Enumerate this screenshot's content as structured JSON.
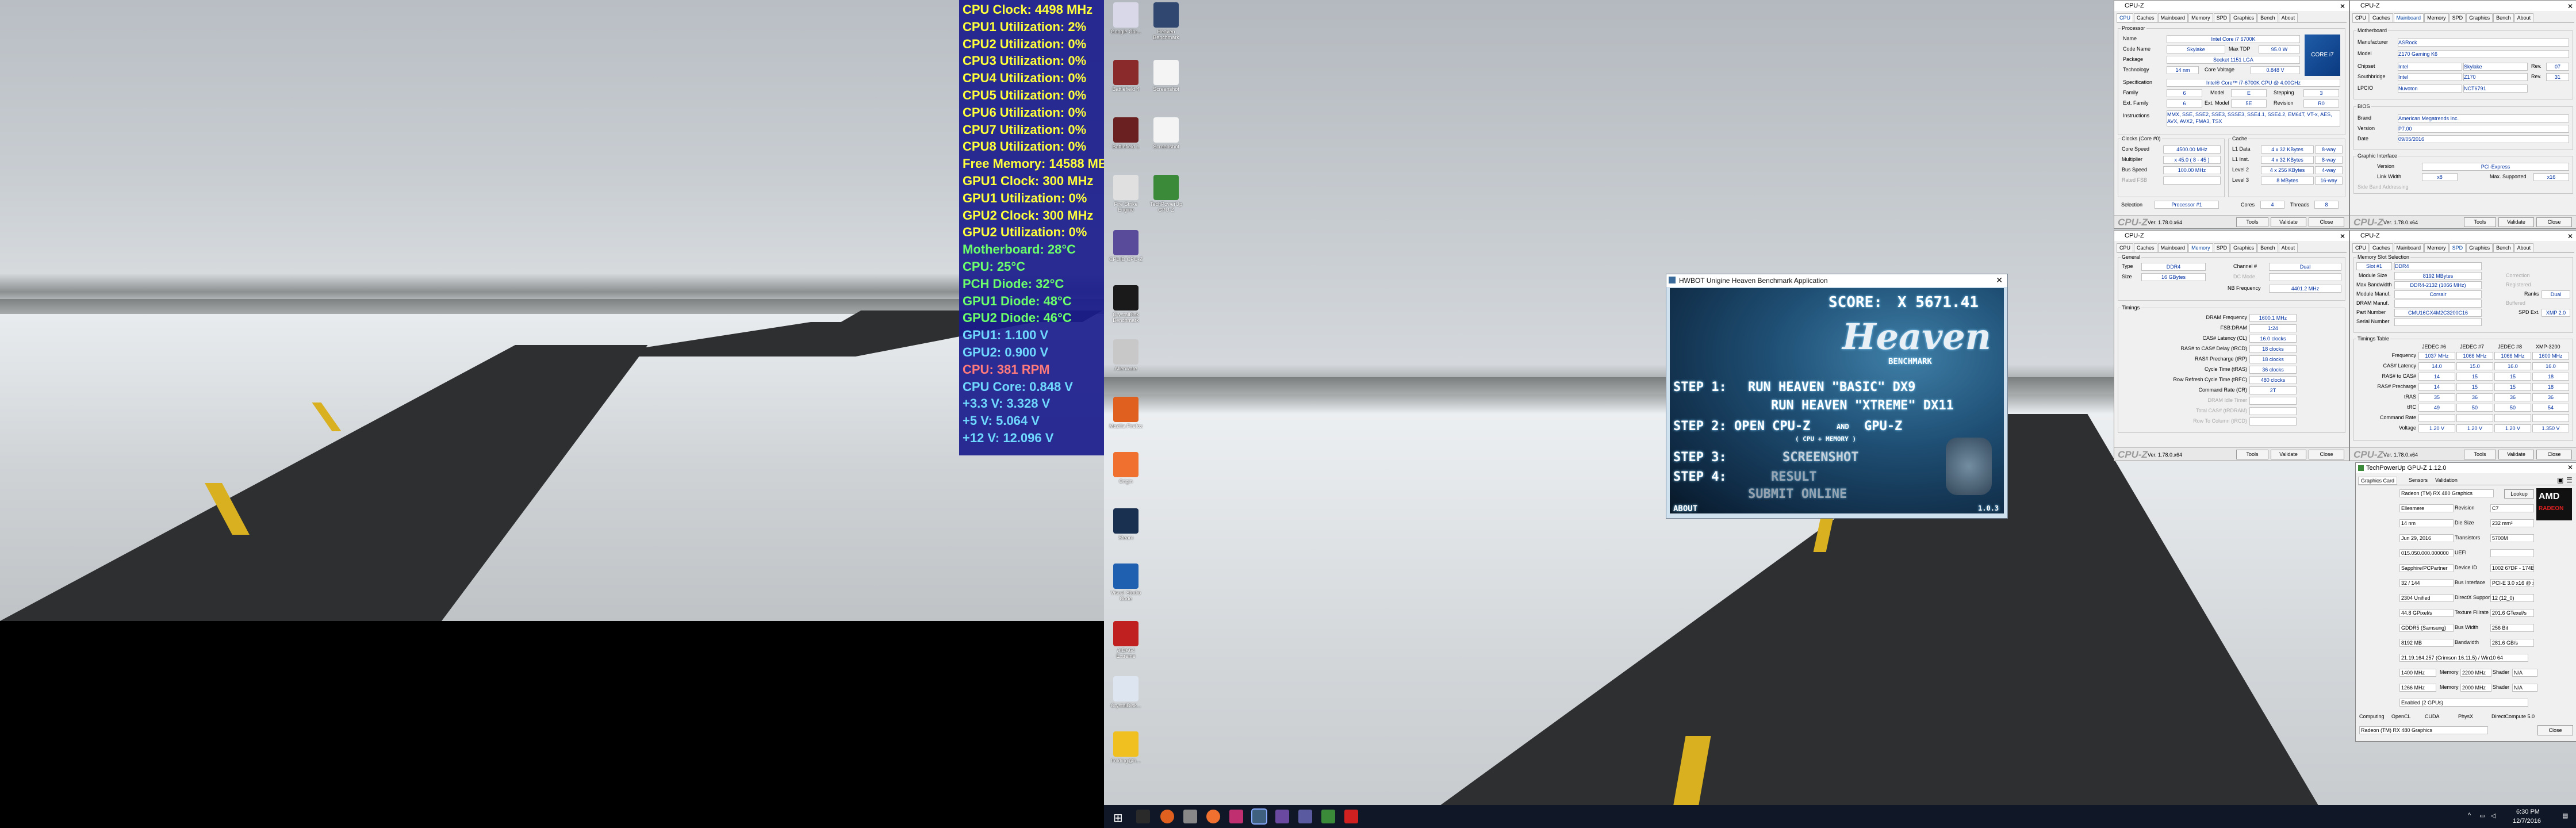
{
  "osd": {
    "lines": [
      {
        "text": "CPU Clock: 4498 MHz",
        "color": "#ffff3c"
      },
      {
        "text": "CPU1 Utilization: 2%",
        "color": "#ffff3c"
      },
      {
        "text": "CPU2 Utilization: 0%",
        "color": "#ffff3c"
      },
      {
        "text": "CPU3 Utilization: 0%",
        "color": "#ffff3c"
      },
      {
        "text": "CPU4 Utilization: 0%",
        "color": "#ffff3c"
      },
      {
        "text": "CPU5 Utilization: 0%",
        "color": "#ffff3c"
      },
      {
        "text": "CPU6 Utilization: 0%",
        "color": "#ffff3c"
      },
      {
        "text": "CPU7 Utilization: 0%",
        "color": "#ffff3c"
      },
      {
        "text": "CPU8 Utilization: 0%",
        "color": "#ffff3c"
      },
      {
        "text": "Free Memory: 14588 MB",
        "color": "#ffff3c"
      },
      {
        "text": "GPU1 Clock: 300 MHz",
        "color": "#ffff3c"
      },
      {
        "text": "GPU1 Utilization: 0%",
        "color": "#ffff3c"
      },
      {
        "text": "GPU2 Clock: 300 MHz",
        "color": "#ffff3c"
      },
      {
        "text": "GPU2 Utilization: 0%",
        "color": "#ffff3c"
      },
      {
        "text": "Motherboard: 28°C",
        "color": "#6cff6c"
      },
      {
        "text": "CPU: 25°C",
        "color": "#6cff6c"
      },
      {
        "text": "PCH Diode: 32°C",
        "color": "#6cff6c"
      },
      {
        "text": "GPU1 Diode: 48°C",
        "color": "#6cff6c"
      },
      {
        "text": "GPU2 Diode: 46°C",
        "color": "#6cff6c"
      },
      {
        "text": "GPU1: 1.100 V",
        "color": "#6fd8ff"
      },
      {
        "text": "GPU2: 0.900 V",
        "color": "#6fd8ff"
      },
      {
        "text": "CPU: 381 RPM",
        "color": "#ff7a7a"
      },
      {
        "text": "CPU Core: 0.848 V",
        "color": "#6fd8ff"
      },
      {
        "text": "+3.3 V: 3.328 V",
        "color": "#6fd8ff"
      },
      {
        "text": "+5 V: 5.064 V",
        "color": "#6fd8ff"
      },
      {
        "text": "+12 V: 12.096 V",
        "color": "#6fd8ff"
      }
    ]
  },
  "desktop_icons": [
    {
      "label": "Google Chr...",
      "icon": "chrome-icon",
      "color": "#d8d8e8"
    },
    {
      "label": "Heaven Benchmark",
      "icon": "heaven-icon",
      "color": "#304870"
    },
    {
      "label": "Battlefield 4",
      "icon": "battlefield-icon",
      "color": "#8a2a2a"
    },
    {
      "label": "Screenshot",
      "icon": "file-icon",
      "color": "#f4f4f4"
    },
    {
      "label": "Battlefield 1",
      "icon": "battlefield-icon",
      "color": "#6a2020"
    },
    {
      "label": "Screenshot",
      "icon": "file-icon",
      "color": "#f4f4f4"
    },
    {
      "label": "Fire Strike Engine",
      "icon": "3dmark-icon",
      "color": "#e0e0e0"
    },
    {
      "label": "TechPowerUp GPU-Z",
      "icon": "gpuz-icon",
      "color": "#3a8a3a"
    },
    {
      "label": "CPUID CPU-Z",
      "icon": "cpuz-icon",
      "color": "#5a4a9a"
    },
    {
      "label": "CrystalDisk Benchmark",
      "icon": "terminal-icon",
      "color": "#1a1a1a"
    },
    {
      "label": "Alienware",
      "icon": "alien-icon",
      "color": "#c8c8c8"
    },
    {
      "label": "Mozilla Firefox",
      "icon": "firefox-icon",
      "color": "#e06020"
    },
    {
      "label": "Origin",
      "icon": "origin-icon",
      "color": "#f07030"
    },
    {
      "label": "Steam",
      "icon": "steam-icon",
      "color": "#1a3050"
    },
    {
      "label": "Visual Studio Code",
      "icon": "vscode-icon",
      "color": "#2060b0"
    },
    {
      "label": "AIDA64 Extreme",
      "icon": "aida64-icon",
      "color": "#c02020"
    },
    {
      "label": "CrystalDisk...",
      "icon": "crystaldisk-icon",
      "color": "#dde6f0"
    },
    {
      "label": "Folding@h...",
      "icon": "folding-icon",
      "color": "#f0c020"
    }
  ],
  "heaven": {
    "title": "HWBOT Unigine Heaven Benchmark Application",
    "score_label": "SCORE:",
    "score_value": "X 5671.41",
    "logo": "Heaven",
    "logo_sub": "BENCHMARK",
    "step1": "STEP 1:",
    "step1_a": "RUN HEAVEN \"BASIC\" DX9",
    "step1_b": "RUN HEAVEN \"XTREME\" DX11",
    "step2": "STEP 2: OPEN CPU-Z",
    "step2_and": "AND",
    "step2_b": "GPU-Z",
    "step2_sub": "( CPU + MEMORY )",
    "step3": "STEP 3:",
    "step3_b": "SCREENSHOT",
    "step4": "STEP 4:",
    "step4_b": "RESULT",
    "submit": "SUBMIT ONLINE",
    "about": "ABOUT",
    "version": "1.0.3"
  },
  "cpuz_common": {
    "title": "CPU-Z",
    "brand": "CPU-Z",
    "version": "Ver. 1.78.0.x64",
    "tools": "Tools",
    "validate": "Validate",
    "close": "Close",
    "tabs": [
      "CPU",
      "Caches",
      "Mainboard",
      "Memory",
      "SPD",
      "Graphics",
      "Bench",
      "About"
    ]
  },
  "cpuz_cpu": {
    "group_processor": "Processor",
    "name_l": "Name",
    "name_v": "Intel Core i7 6700K",
    "code_l": "Code Name",
    "code_v": "Skylake",
    "tdp_l": "Max TDP",
    "tdp_v": "95.0 W",
    "pkg_l": "Package",
    "pkg_v": "Socket 1151 LGA",
    "tech_l": "Technology",
    "tech_v": "14 nm",
    "cv_l": "Core Voltage",
    "cv_v": "0.848 V",
    "spec_l": "Specification",
    "spec_v": "Intel® Core™ i7-6700K CPU @ 4.00GHz",
    "fam_l": "Family",
    "fam_v": "6",
    "model_l": "Model",
    "model_v": "E",
    "step_l": "Stepping",
    "step_v": "3",
    "extfam_l": "Ext. Family",
    "extfam_v": "6",
    "extmod_l": "Ext. Model",
    "extmod_v": "5E",
    "rev_l": "Revision",
    "rev_v": "R0",
    "instr_l": "Instructions",
    "instr_v": "MMX, SSE, SSE2, SSE3, SSSE3, SSE4.1, SSE4.2, EM64T, VT-x, AES, AVX, AVX2, FMA3, TSX",
    "group_clocks": "Clocks (Core #0)",
    "cspeed_l": "Core Speed",
    "cspeed_v": "4500.00 MHz",
    "mult_l": "Multiplier",
    "mult_v": "x 45.0 ( 8 - 45 )",
    "bus_l": "Bus Speed",
    "bus_v": "100.00 MHz",
    "fsb_l": "Rated FSB",
    "fsb_v": "",
    "group_cache": "Cache",
    "l1d_l": "L1 Data",
    "l1d_v": "4 x 32 KBytes",
    "l1d_w": "8-way",
    "l1i_l": "L1 Inst.",
    "l1i_v": "4 x 32 KBytes",
    "l1i_w": "8-way",
    "l2_l": "Level 2",
    "l2_v": "4 x 256 KBytes",
    "l2_w": "4-way",
    "l3_l": "Level 3",
    "l3_v": "8 MBytes",
    "l3_w": "16-way",
    "sel_l": "Selection",
    "sel_v": "Processor #1",
    "cores_l": "Cores",
    "cores_v": "4",
    "threads_l": "Threads",
    "threads_v": "8",
    "intel_badge": "CORE i7"
  },
  "cpuz_mb": {
    "group_mb": "Motherboard",
    "manu_l": "Manufacturer",
    "manu_v": "ASRock",
    "model_l": "Model",
    "model_v": "Z170 Gaming K6",
    "chip_l": "Chipset",
    "chip_v": "Intel",
    "chip_v2": "Skylake",
    "chip_rl": "Rev.",
    "chip_r": "07",
    "south_l": "Southbridge",
    "south_v": "Intel",
    "south_v2": "Z170",
    "south_rl": "Rev.",
    "south_r": "31",
    "lpcio_l": "LPCIO",
    "lpcio_v": "Nuvoton",
    "lpcio_v2": "NCT6791",
    "group_bios": "BIOS",
    "brand_l": "Brand",
    "brand_v": "American Megatrends Inc.",
    "bver_l": "Version",
    "bver_v": "P7.00",
    "date_l": "Date",
    "date_v": "09/05/2016",
    "group_gi": "Graphic Interface",
    "gver_l": "Version",
    "gver_v": "PCI-Express",
    "lw_l": "Link Width",
    "lw_v": "x8",
    "ms_l": "Max. Supported",
    "ms_v": "x16",
    "sba_l": "Side Band Addressing"
  },
  "cpuz_mem": {
    "group_gen": "General",
    "type_l": "Type",
    "type_v": "DDR4",
    "ch_l": "Channel #",
    "ch_v": "Dual",
    "size_l": "Size",
    "size_v": "16 GBytes",
    "dc_l": "DC Mode",
    "dc_v": "",
    "nb_l": "NB Frequency",
    "nb_v": "4401.2 MHz",
    "group_tim": "Timings",
    "rows": [
      {
        "l": "DRAM Frequency",
        "v": "1600.1 MHz"
      },
      {
        "l": "FSB:DRAM",
        "v": "1:24"
      },
      {
        "l": "CAS# Latency (CL)",
        "v": "16.0 clocks"
      },
      {
        "l": "RAS# to CAS# Delay (tRCD)",
        "v": "18 clocks"
      },
      {
        "l": "RAS# Precharge (tRP)",
        "v": "18 clocks"
      },
      {
        "l": "Cycle Time (tRAS)",
        "v": "36 clocks"
      },
      {
        "l": "Row Refresh Cycle Time (tRFC)",
        "v": "480 clocks"
      },
      {
        "l": "Command Rate (CR)",
        "v": "2T"
      },
      {
        "l": "DRAM Idle Timer",
        "v": ""
      },
      {
        "l": "Total CAS# (tRDRAM)",
        "v": ""
      },
      {
        "l": "Row To Column (tRCD)",
        "v": ""
      }
    ]
  },
  "cpuz_spd": {
    "group_slot": "Memory Slot Selection",
    "slot_v": "Slot #1",
    "slot_type": "DDR4",
    "msize_l": "Module Size",
    "msize_v": "8192 MBytes",
    "maxbw_l": "Max Bandwidth",
    "maxbw_v": "DDR4-2132 (1066 MHz)",
    "manu_l": "Module Manuf.",
    "manu_v": "Corsair",
    "dram_l": "DRAM Manuf.",
    "dram_v": "",
    "part_l": "Part Number",
    "part_v": "CMU16GX4M2C3200C16",
    "serial_l": "Serial Number",
    "serial_v": "",
    "corr_l": "Correction",
    "reg_l": "Registered",
    "buf_l": "Buffered",
    "spd_l": "SPD Ext.",
    "spd_v": "XMP 2.0",
    "ranks_l": "Ranks",
    "ranks_v": "Dual",
    "group_tt": "Timings Table",
    "cols": [
      "JEDEC #6",
      "JEDEC #7",
      "JEDEC #8",
      "XMP-3200"
    ],
    "trows": [
      {
        "l": "Frequency",
        "v": [
          "1037 MHz",
          "1066 MHz",
          "1066 MHz",
          "1600 MHz"
        ]
      },
      {
        "l": "CAS# Latency",
        "v": [
          "14.0",
          "15.0",
          "16.0",
          "16.0"
        ]
      },
      {
        "l": "RAS# to CAS#",
        "v": [
          "14",
          "15",
          "15",
          "18"
        ]
      },
      {
        "l": "RAS# Precharge",
        "v": [
          "14",
          "15",
          "15",
          "18"
        ]
      },
      {
        "l": "tRAS",
        "v": [
          "35",
          "36",
          "36",
          "36"
        ]
      },
      {
        "l": "tRC",
        "v": [
          "49",
          "50",
          "50",
          "54"
        ]
      },
      {
        "l": "Command Rate",
        "v": [
          "",
          "",
          "",
          ""
        ]
      },
      {
        "l": "Voltage",
        "v": [
          "1.20 V",
          "1.20 V",
          "1.20 V",
          "1.350 V"
        ]
      }
    ]
  },
  "gpuz": {
    "title": "TechPowerUp GPU-Z 1.12.0",
    "tabs": [
      "Graphics Card",
      "Sensors",
      "Validation"
    ],
    "lookup": "Lookup",
    "close": "Close",
    "rows": [
      {
        "l": "Name",
        "v": "Radeon (TM) RX 480 Graphics"
      },
      {
        "l": "GPU",
        "v": "Ellesmere",
        "l2": "Revision",
        "v2": "C7"
      },
      {
        "l": "Technology",
        "v": "14 nm",
        "l2": "Die Size",
        "v2": "232 mm²"
      },
      {
        "l": "Release Date",
        "v": "Jun 29, 2016",
        "l2": "Transistors",
        "v2": "5700M"
      },
      {
        "l": "BIOS Version",
        "v": "015.050.000.000000",
        "l2": "UEFI",
        "v2": ""
      },
      {
        "l": "Subvendor",
        "v": "Sapphire/PCPartner",
        "l2": "Device ID",
        "v2": "1002 67DF - 174B E347"
      },
      {
        "l": "ROPs/TMUs",
        "v": "32 / 144",
        "l2": "Bus Interface",
        "v2": "PCI-E 3.0 x16 @ x8 1.1"
      },
      {
        "l": "Shaders",
        "v": "2304 Unified",
        "l2": "DirectX Support",
        "v2": "12 (12_0)"
      },
      {
        "l": "Pixel Fillrate",
        "v": "44.8 GPixel/s",
        "l2": "Texture Fillrate",
        "v2": "201.6 GTexel/s"
      },
      {
        "l": "Memory Type",
        "v": "GDDR5 (Samsung)",
        "l2": "Bus Width",
        "v2": "256 Bit"
      },
      {
        "l": "Memory Size",
        "v": "8192 MB",
        "l2": "Bandwidth",
        "v2": "281.6 GB/s"
      },
      {
        "l": "Driver Version",
        "v": "21.19.164.257 (Crimson 16.11.5) / Win10 64"
      },
      {
        "l": "GPU Clock",
        "v": "1400 MHz",
        "l2": "Memory",
        "v2": "2200 MHz",
        "l3": "Shader",
        "v3": "N/A"
      },
      {
        "l": "Default Clock",
        "v": "1266 MHz",
        "l2": "Memory",
        "v2": "2000 MHz",
        "l3": "Shader",
        "v3": "N/A"
      },
      {
        "l": "AMD CrossFire",
        "v": "Enabled (2 GPUs)"
      }
    ],
    "computing_l": "Computing",
    "computing": [
      "OpenCL",
      "CUDA",
      "PhysX",
      "DirectCompute 5.0"
    ],
    "card_sel": "Radeon (TM) RX 480 Graphics",
    "amd_logo": "AMD",
    "radeon_logo": "RADEON"
  },
  "taskbar": {
    "time": "6:30 PM",
    "date": "12/7/2016"
  }
}
